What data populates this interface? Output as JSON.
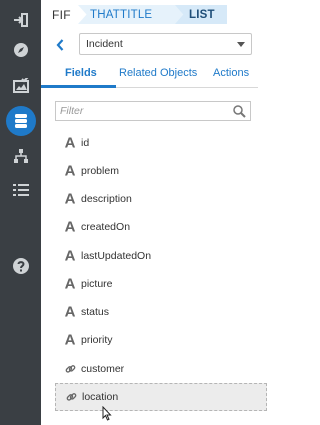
{
  "rail": {
    "items": [
      {
        "icon": "sign-in-icon"
      },
      {
        "icon": "compass-icon"
      },
      {
        "icon": "image-check-icon"
      },
      {
        "icon": "database-icon",
        "active": true
      },
      {
        "icon": "sitemap-icon"
      },
      {
        "icon": "list-icon"
      },
      {
        "icon": "help-icon"
      }
    ],
    "accent": "#1f7ac9"
  },
  "breadcrumb": {
    "root": "FIF",
    "items": [
      "THATTITLE",
      "LIST"
    ]
  },
  "object_select": {
    "value": "Incident"
  },
  "tabs": [
    "Fields",
    "Related Objects",
    "Actions"
  ],
  "active_tab": "Fields",
  "filter": {
    "placeholder": "Filter"
  },
  "fields": [
    {
      "name": "id",
      "type": "text"
    },
    {
      "name": "problem",
      "type": "text"
    },
    {
      "name": "description",
      "type": "text"
    },
    {
      "name": "createdOn",
      "type": "text"
    },
    {
      "name": "lastUpdatedOn",
      "type": "text"
    },
    {
      "name": "picture",
      "type": "text"
    },
    {
      "name": "status",
      "type": "text"
    },
    {
      "name": "priority",
      "type": "text"
    },
    {
      "name": "customer",
      "type": "link"
    },
    {
      "name": "location",
      "type": "link",
      "hovered": true
    }
  ]
}
